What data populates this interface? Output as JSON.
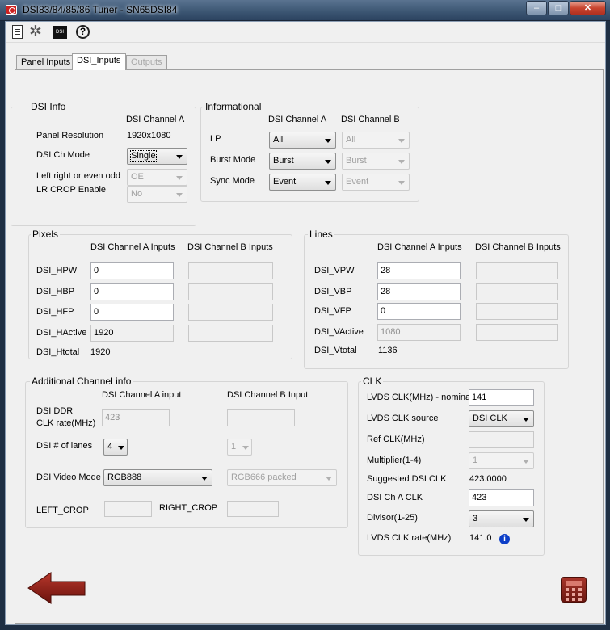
{
  "window": {
    "title": "DSI83/84/85/86 Tuner - SN65DSI84",
    "min_glyph": "–",
    "max_glyph": "□",
    "close_glyph": "✕"
  },
  "toolbar": {
    "dsi_icon_text": "DSI",
    "gear_glyph": "✲",
    "help_glyph": "?"
  },
  "tabs": [
    {
      "label": "Panel Inputs"
    },
    {
      "label": "DSI_Inputs"
    },
    {
      "label": "Outputs"
    }
  ],
  "dsi_info": {
    "title": "DSI Info",
    "channel_a_header": "DSI Channel A",
    "panel_resolution_label": "Panel Resolution",
    "panel_resolution_value": "1920x1080",
    "ch_mode_label": "DSI Ch Mode",
    "ch_mode_value": "Single",
    "left_right_label": "Left right or even odd",
    "left_right_value": "OE",
    "lr_crop_label": "LR CROP Enable",
    "lr_crop_value": "No"
  },
  "informational": {
    "title": "Informational",
    "header_a": "DSI Channel A",
    "header_b": "DSI Channel B",
    "rows": [
      {
        "label": "LP",
        "a": "All",
        "b": "All"
      },
      {
        "label": "Burst Mode",
        "a": "Burst",
        "b": "Burst"
      },
      {
        "label": "Sync Mode",
        "a": "Event",
        "b": "Event"
      }
    ]
  },
  "pixels": {
    "title": "Pixels",
    "header_a": "DSI Channel A Inputs",
    "header_b": "DSI Channel B Inputs",
    "rows": [
      {
        "label": "DSI_HPW",
        "a": "0",
        "b": ""
      },
      {
        "label": "DSI_HBP",
        "a": "0",
        "b": ""
      },
      {
        "label": "DSI_HFP",
        "a": "0",
        "b": ""
      },
      {
        "label": "DSI_HActive",
        "a": "1920",
        "b": ""
      }
    ],
    "total_label": "DSI_Htotal",
    "total_value": "1920"
  },
  "lines": {
    "title": "Lines",
    "header_a": "DSI Channel A Inputs",
    "header_b": "DSI Channel B Inputs",
    "rows": [
      {
        "label": "DSI_VPW",
        "a": "28",
        "b": ""
      },
      {
        "label": "DSI_VBP",
        "a": "28",
        "b": ""
      },
      {
        "label": "DSI_VFP",
        "a": "0",
        "b": ""
      },
      {
        "label": "DSI_VActive",
        "a": "1080",
        "b": ""
      }
    ],
    "total_label": "DSI_Vtotal",
    "total_value": "1136"
  },
  "additional": {
    "title": "Additional Channel info",
    "header_a": "DSI Channel A input",
    "header_b": "DSI Channel B Input",
    "ddr_label_1": "DSI DDR",
    "ddr_label_2": "CLK rate(MHz)",
    "ddr_a": "423",
    "ddr_b": "",
    "lanes_label": "DSI # of lanes",
    "lanes_a": "4",
    "lanes_b": "1",
    "video_mode_label": "DSI Video Mode",
    "video_mode_a": "RGB888",
    "video_mode_b": "RGB666 packed",
    "left_crop_label": "LEFT_CROP",
    "left_crop_value": "",
    "right_crop_label": "RIGHT_CROP",
    "right_crop_value": ""
  },
  "clk": {
    "title": "CLK",
    "lvds_nominal_label": "LVDS CLK(MHz) - nominal",
    "lvds_nominal_value": "141",
    "lvds_source_label": "LVDS CLK source",
    "lvds_source_value": "DSI CLK",
    "ref_clk_label": "Ref CLK(MHz)",
    "ref_clk_value": "",
    "multiplier_label": "Multiplier(1-4)",
    "multiplier_value": "1",
    "suggested_label": "Suggested DSI CLK",
    "suggested_value": "423.0000",
    "ch_a_clk_label": "DSI Ch A CLK",
    "ch_a_clk_value": "423",
    "divisor_label": "Divisor(1-25)",
    "divisor_value": "3",
    "lvds_rate_label": "LVDS CLK rate(MHz)",
    "lvds_rate_value": "141.0",
    "info_glyph": "i"
  },
  "colors": {
    "accent_back_arrow": "#8b1a12",
    "info_icon": "#0d3fc8"
  }
}
